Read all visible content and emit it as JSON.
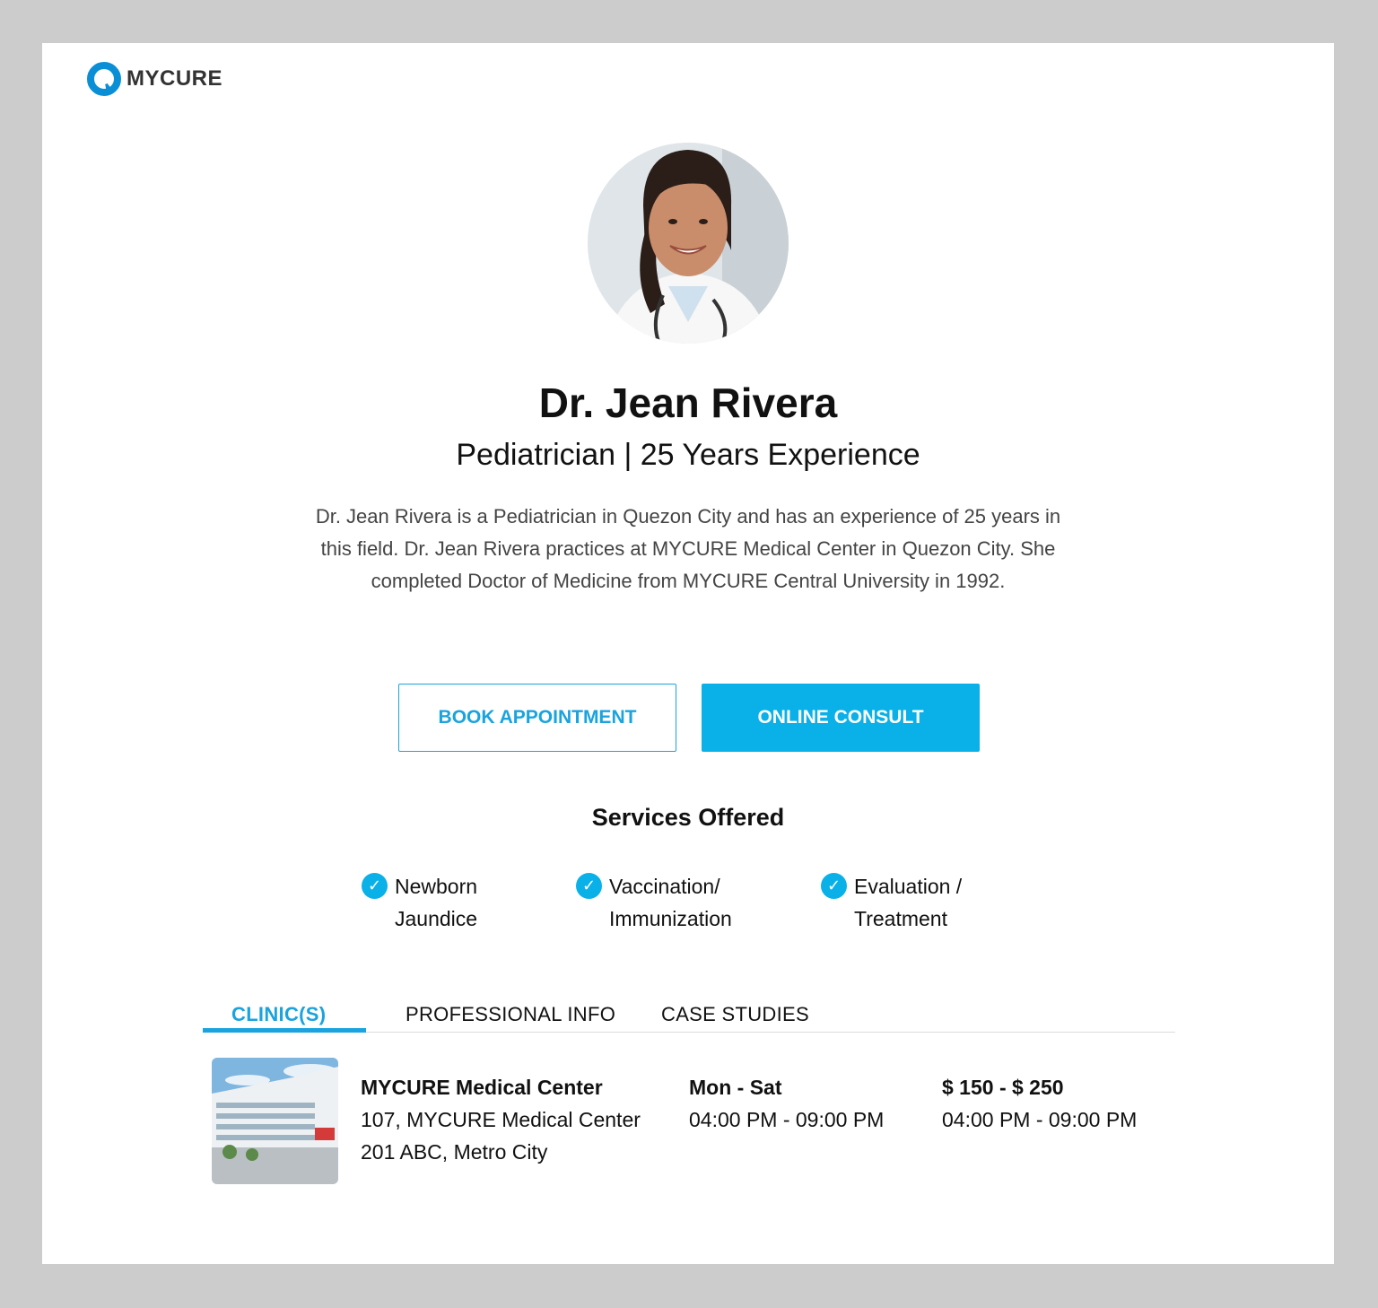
{
  "brand": {
    "name": "MYCURE",
    "accent": "#0ab0e8"
  },
  "doctor": {
    "name": "Dr. Jean Rivera",
    "subtitle": "Pediatrician | 25 Years Experience",
    "bio": "Dr. Jean Rivera is a Pediatrician in Quezon City and has an experience of 25 years in this field. Dr. Jean Rivera practices at MYCURE Medical Center in Quezon City. She completed Doctor of Medicine from MYCURE Central University in 1992."
  },
  "actions": {
    "book": "BOOK APPOINTMENT",
    "consult": "ONLINE CONSULT"
  },
  "services": {
    "title": "Services Offered",
    "items": [
      {
        "label": "Newborn\nJaundice"
      },
      {
        "label": "Vaccination/\nImmunization"
      },
      {
        "label": "Evaluation /\nTreatment"
      }
    ]
  },
  "tabs": [
    {
      "label": "CLINIC(S)",
      "active": true
    },
    {
      "label": "PROFESSIONAL INFO",
      "active": false
    },
    {
      "label": "CASE STUDIES",
      "active": false
    }
  ],
  "clinic": {
    "name": "MYCURE Medical Center",
    "address_line1": "107, MYCURE Medical Center",
    "address_line2": "201 ABC, Metro City",
    "days": "Mon - Sat",
    "hours": "04:00 PM - 09:00 PM",
    "price": "$ 150 - $ 250",
    "price_hours": "04:00 PM - 09:00 PM"
  }
}
